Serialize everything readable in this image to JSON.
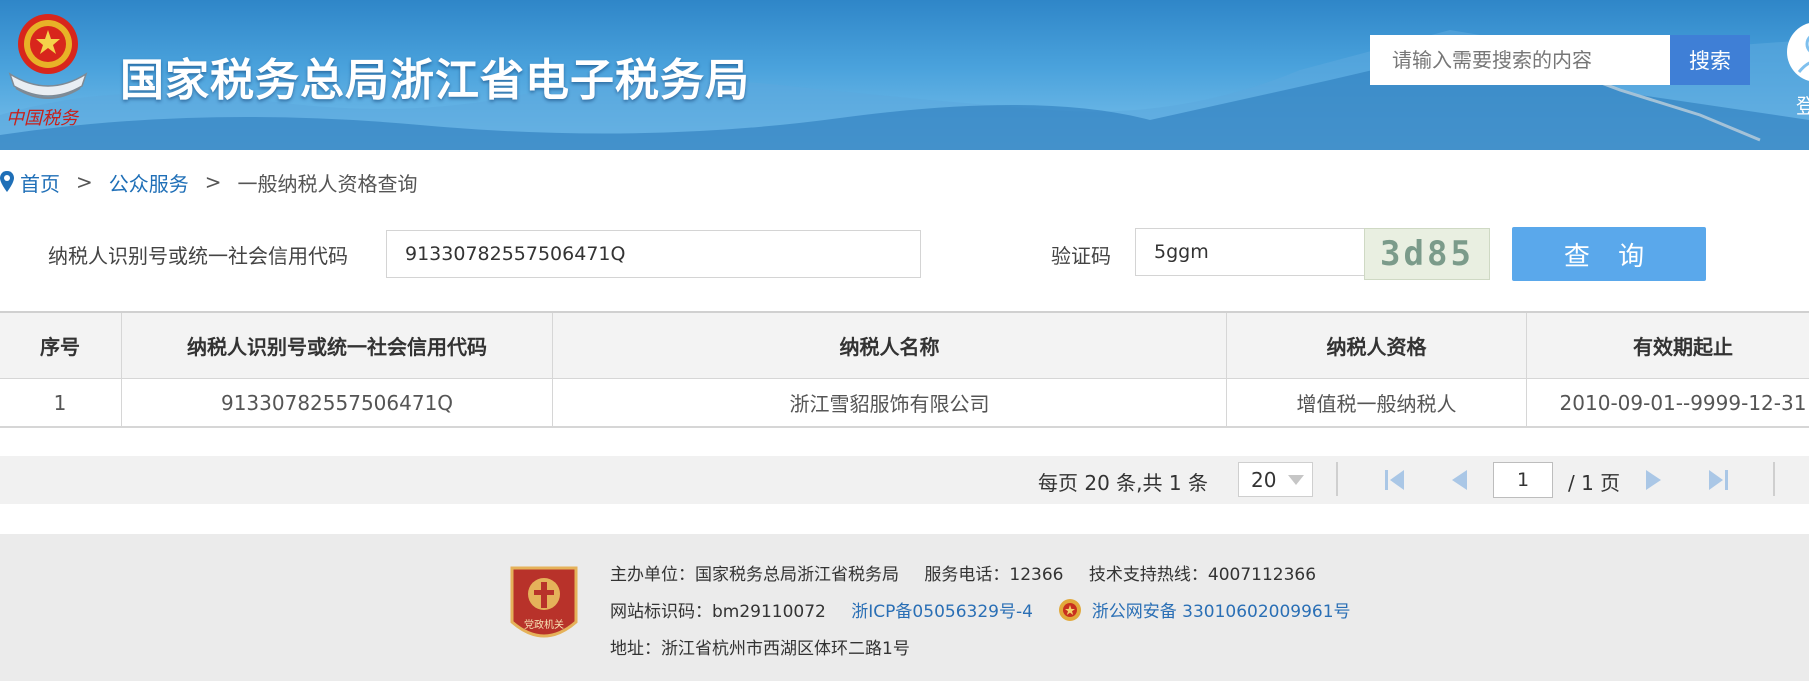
{
  "header": {
    "site_title": "国家税务总局浙江省电子税务局",
    "emblem_caption": "中国税务",
    "search": {
      "placeholder": "请输入需要搜索的内容",
      "button_label": "搜索"
    },
    "login_label": "登"
  },
  "breadcrumb": {
    "items": [
      {
        "label": "首页"
      },
      {
        "label": "公众服务"
      },
      {
        "label": "一般纳税人资格查询"
      }
    ],
    "separator": ">"
  },
  "query_form": {
    "taxid_label": "纳税人识别号或统一社会信用代码",
    "taxid_value": "91330782557506471Q",
    "captcha_label": "验证码",
    "captcha_value": "5ggm",
    "captcha_image_text": "3d85",
    "query_button": "查 询"
  },
  "results_table": {
    "columns": [
      "序号",
      "纳税人识别号或统一社会信用代码",
      "纳税人名称",
      "纳税人资格",
      "有效期起止"
    ],
    "rows": [
      [
        "1",
        "91330782557506471Q",
        "浙江雪貂服饰有限公司",
        "增值税一般纳税人",
        "2010-09-01--9999-12-31"
      ]
    ]
  },
  "pagination": {
    "summary": "每页 20 条,共 1 条",
    "page_size": "20",
    "current_page": "1",
    "total_pages_text": "/ 1 页"
  },
  "footer": {
    "sponsor": "主办单位：国家税务总局浙江省税务局",
    "service_phone": "服务电话：12366",
    "support_hotline": "技术支持热线：4007112366",
    "site_id": "网站标识码：bm29110072",
    "icp": "浙ICP备05056329号-4",
    "police_record": "浙公网安备 33010602009961号",
    "address": "地址：浙江省杭州市西湖区体环二路1号",
    "badge_text": "党政机关"
  },
  "colors": {
    "header_blue": "#3b90d0",
    "link_blue": "#1f6fb7",
    "search_button": "#3f7fd6",
    "query_button": "#5aa8eb",
    "footer_bg": "#ebebeb",
    "badge_red": "#b8322a"
  },
  "icons": [
    "tax-emblem-icon",
    "user-avatar-icon",
    "location-pin-icon",
    "dropdown-caret-icon",
    "first-page-icon",
    "prev-page-icon",
    "next-page-icon",
    "last-page-icon",
    "party-badge-icon",
    "police-badge-icon"
  ]
}
